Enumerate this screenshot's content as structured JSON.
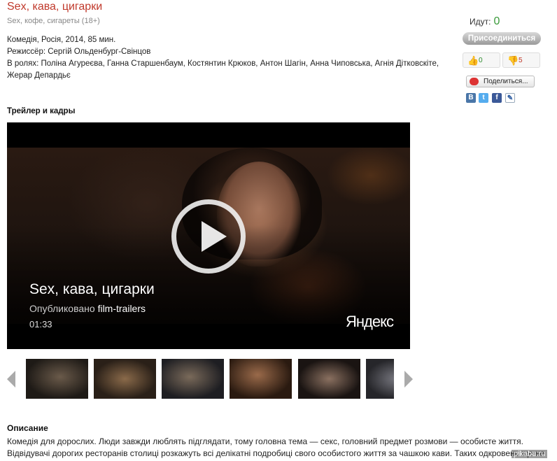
{
  "movie": {
    "title": "Sex, кава, цигарки",
    "subtitle": "Sex, кофе, сигареты (18+)",
    "info_line": "Комедія, Росія, 2014, 85 мин.",
    "director": "Режиссёр: Сергій Ольденбург-Свінцов",
    "cast": "В ролях: Поліна Агуреєва, Ганна Старшенбаум, Костянтин Крюков, Антон Шагін, Анна Чиповська, Агнія Дітковскіте, Жерар Депардьє"
  },
  "trailer": {
    "section_title": "Трейлер и кадры",
    "video_title": "Sex, кава, цигарки",
    "published_prefix": "Опубликовано",
    "published_by": "film-trailers",
    "duration": "01:33",
    "brand": "Яндекс"
  },
  "thumbnails": [
    "frame-1",
    "frame-2",
    "frame-3",
    "frame-4",
    "frame-5",
    "frame-6"
  ],
  "description": {
    "heading": "Описание",
    "text": "Комедія для дорослих. Люди завжди люблять підглядати, тому головна тема — секс, головний предмет розмови — особисте життя. Відвідувачі дорогих ресторанів столиці розкажуть всі делікатні подробиці свого особистого життя за чашкою кави. Таких одкровень ще не було ніколи!"
  },
  "sidebar": {
    "going_label": "Идут:",
    "going_count": "0",
    "join_label": "Присоединиться",
    "likes": "0",
    "dislikes": "5",
    "share_label": "Поделиться...",
    "socials": [
      "В",
      "t",
      "f",
      "✎"
    ]
  },
  "watermark": "pikabu.ru",
  "colors": {
    "title": "#c0392b",
    "accent_green": "#3a9a3a"
  }
}
